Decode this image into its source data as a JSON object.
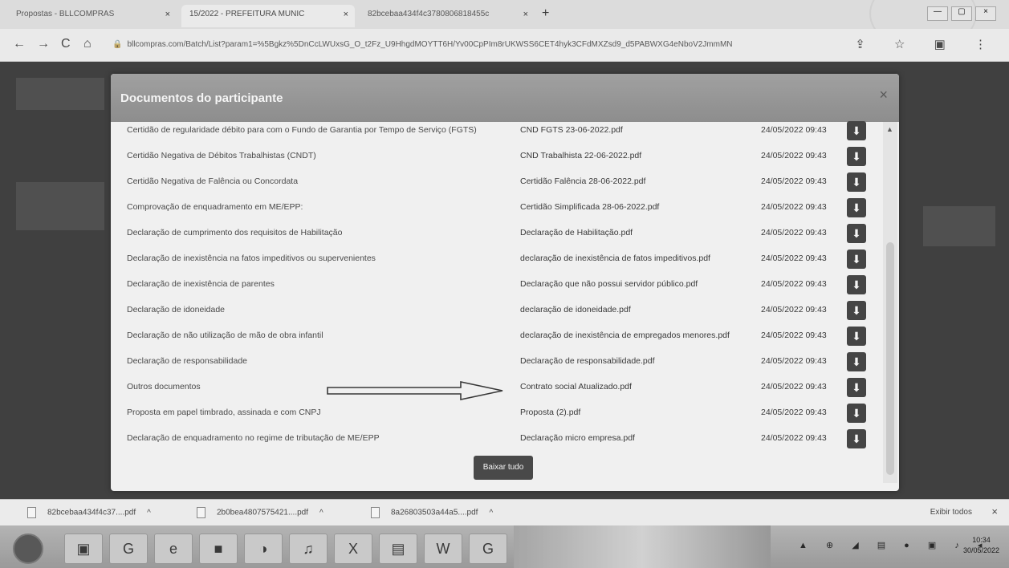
{
  "browser": {
    "tabs": [
      {
        "label": "Propostas - BLLCOMPRAS",
        "close": "×"
      },
      {
        "label": "15/2022 - PREFEITURA MUNIC",
        "close": "×"
      },
      {
        "label": "82bcebaa434f4c3780806818455c",
        "close": "×"
      }
    ],
    "new_tab": "+",
    "url": "bllcompras.com/Batch/List?param1=%5Bgkz%5DnCcLWUxsG_O_t2Fz_U9HhgdMOYTT6H/Yv00CpPIm8rUKWSS6CET4hyk3CFdMXZsd9_d5PABWXG4eNboV2JmmMN",
    "nav": {
      "back": "←",
      "forward": "→",
      "reload": "C",
      "home": "⌂"
    },
    "addr_icons": "⇪ ☆ ▣ ⋮",
    "window_controls": [
      "—",
      "▢",
      "×"
    ]
  },
  "modal": {
    "title": "Documentos do participante",
    "close": "×",
    "documents": [
      {
        "label": "Certidão de regularidade débito para com o Fundo de Garantia por Tempo de Serviço (FGTS)",
        "file": "CND FGTS 23-06-2022.pdf",
        "date": "24/05/2022 09:43"
      },
      {
        "label": "Certidão Negativa de Débitos Trabalhistas (CNDT)",
        "file": "CND Trabalhista 22-06-2022.pdf",
        "date": "24/05/2022 09:43"
      },
      {
        "label": "Certidão Negativa de Falência ou Concordata",
        "file": "Certidão Falência 28-06-2022.pdf",
        "date": "24/05/2022 09:43"
      },
      {
        "label": "Comprovação de enquadramento em ME/EPP:",
        "file": "Certidão Simplificada 28-06-2022.pdf",
        "date": "24/05/2022 09:43"
      },
      {
        "label": "Declaração de cumprimento dos requisitos de Habilitação",
        "file": "Declaração de Habilitação.pdf",
        "date": "24/05/2022 09:43"
      },
      {
        "label": "Declaração de inexistência na fatos impeditivos ou supervenientes",
        "file": "declaração de inexistência de fatos impeditivos.pdf",
        "date": "24/05/2022 09:43"
      },
      {
        "label": "Declaração de inexistência de parentes",
        "file": "Declaração que não possui servidor público.pdf",
        "date": "24/05/2022 09:43"
      },
      {
        "label": "Declaração de idoneidade",
        "file": "declaração de idoneidade.pdf",
        "date": "24/05/2022 09:43"
      },
      {
        "label": "Declaração de não utilização de mão de obra infantil",
        "file": "declaração de inexistência de empregados menores.pdf",
        "date": "24/05/2022 09:43"
      },
      {
        "label": "Declaração de responsabilidade",
        "file": "Declaração de responsabilidade.pdf",
        "date": "24/05/2022 09:43"
      },
      {
        "label": "Outros documentos",
        "file": "Contrato social Atualizado.pdf",
        "date": "24/05/2022 09:43"
      },
      {
        "label": "Proposta em papel timbrado, assinada e com CNPJ",
        "file": "Proposta (2).pdf",
        "date": "24/05/2022 09:43"
      },
      {
        "label": "Declaração de enquadramento no regime de tributação de ME/EPP",
        "file": "Declaração micro empresa.pdf",
        "date": "24/05/2022 09:43"
      }
    ],
    "download_icon": "⬇",
    "download_all": "Baixar tudo",
    "scroll_up": "▲"
  },
  "downloads": {
    "items": [
      {
        "name": "82bcebaa434f4c37....pdf",
        "caret": "^"
      },
      {
        "name": "2b0bea4807575421....pdf",
        "caret": "^"
      },
      {
        "name": "8a26803503a44a5....pdf",
        "caret": "^"
      }
    ],
    "show_all": "Exibir todos",
    "close": "×"
  },
  "taskbar": {
    "apps": [
      "▣",
      "G",
      "e",
      "■",
      "◑",
      "♫",
      "X",
      "▤",
      "W",
      "G"
    ],
    "tray": "▲ ⊕ ◢ ▤ ● ▣ ♪ ◂",
    "time": "10:34",
    "date": "30/05/2022"
  }
}
